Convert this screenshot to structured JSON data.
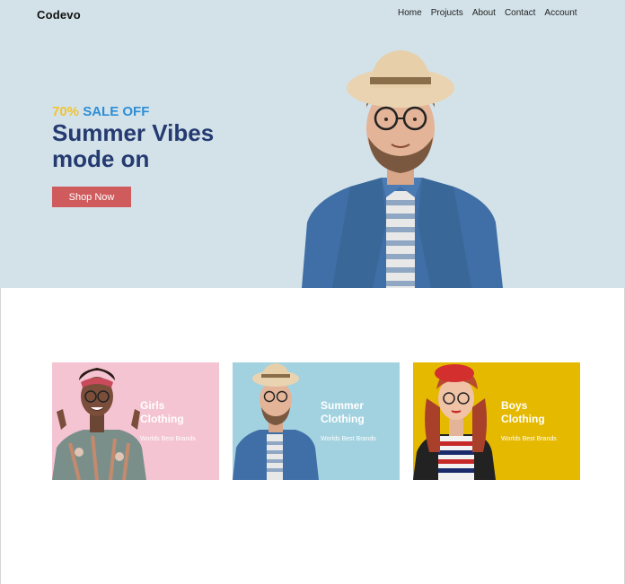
{
  "brand": {
    "name": "Codevo"
  },
  "nav": {
    "items": [
      {
        "label": "Home"
      },
      {
        "label": "Projucts"
      },
      {
        "label": "About"
      },
      {
        "label": "Contact"
      },
      {
        "label": "Account"
      }
    ]
  },
  "hero": {
    "sale_percent": "70%",
    "sale_text": "SALE OFF",
    "headline_line1": "Summer Vibes",
    "headline_line2": "mode on",
    "cta_label": "Shop Now",
    "colors": {
      "background": "#d3e2e9",
      "headline": "#243a70",
      "sale_percent": "#f2c230",
      "sale_text": "#2d8ed6",
      "cta": "#cf5b5d"
    }
  },
  "categories": [
    {
      "title_line1": "Girls",
      "title_line2": "Clothing",
      "subtitle": "Worlds Best Brands",
      "color": "#f5c4d3"
    },
    {
      "title_line1": "Summer",
      "title_line2": "Clothing",
      "subtitle": "Worlds Best Brands",
      "color": "#a2d2e0"
    },
    {
      "title_line1": "Boys",
      "title_line2": "Clothing",
      "subtitle": "Worlds Best Brands",
      "color": "#e5b900"
    }
  ]
}
